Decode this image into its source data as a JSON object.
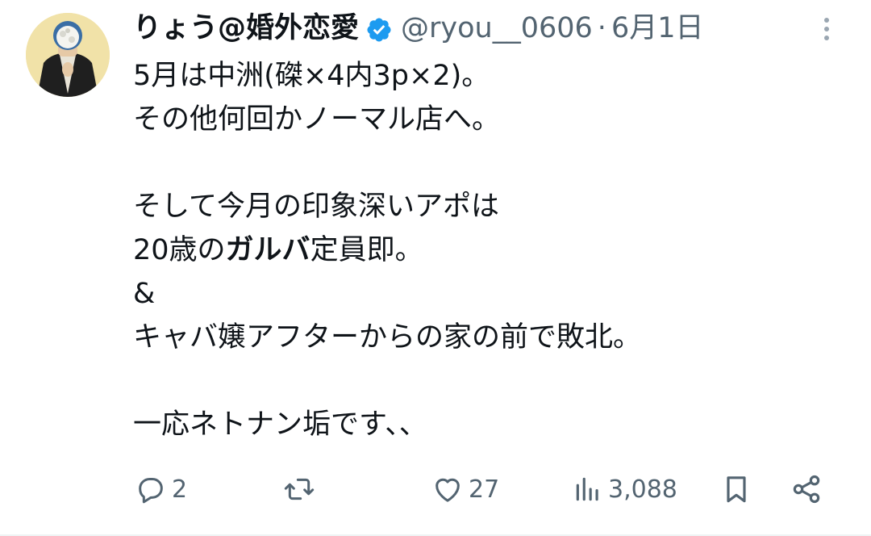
{
  "tweet": {
    "display_name": "りょう@婚外恋愛",
    "handle": "@ryou__0606",
    "separator": "·",
    "date": "6月1日",
    "avatar_icon": "user-avatar",
    "verified_icon": "verified-badge-icon",
    "more_icon": "more-vertical-icon",
    "lines": [
      "5月は中洲(磔×4内3p×2)。",
      "その他何回かノーマル店へ。",
      "",
      "そして今月の印象深いアポは",
      "20歳の",
      "&",
      "キャバ嬢アフターからの家の前で敗北。",
      "",
      "一応ネトナン垢です、、"
    ],
    "line5_bold": "ガルバ",
    "line5_rest": "定員即。"
  },
  "actions": {
    "reply": {
      "icon": "reply-icon",
      "count": "2"
    },
    "retweet": {
      "icon": "retweet-icon",
      "count": ""
    },
    "like": {
      "icon": "heart-icon",
      "count": "27"
    },
    "views": {
      "icon": "views-chart-icon",
      "count": "3,088"
    },
    "bookmark": {
      "icon": "bookmark-icon"
    },
    "share": {
      "icon": "share-icon"
    }
  },
  "colors": {
    "text": "#0f1419",
    "secondary": "#536471",
    "verified": "#1d9bf0"
  }
}
